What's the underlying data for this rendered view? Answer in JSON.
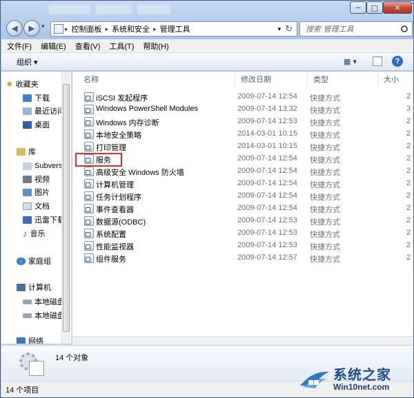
{
  "titlebar": {
    "minimize_glyph": "─",
    "maximize_glyph": "□",
    "close_glyph": "✕"
  },
  "address": {
    "back_glyph": "◀",
    "forward_glyph": "▶",
    "dropdown_glyph": "▾",
    "refresh_glyph": "↻",
    "crumbs": [
      "控制面板",
      "系统和安全",
      "管理工具"
    ],
    "search_placeholder": "搜索 管理工具"
  },
  "menu": [
    "文件(F)",
    "编辑(E)",
    "查看(V)",
    "工具(T)",
    "帮助(H)"
  ],
  "toolbar": {
    "organize_label": "组织 ▾",
    "view_glyph": "▦ ▾",
    "help_glyph": "?"
  },
  "sidebar": {
    "favorites": "收藏夹",
    "fav_items": [
      "下载",
      "最近访问",
      "桌面"
    ],
    "libraries": "库",
    "lib_items": [
      "Subvers",
      "视频",
      "图片",
      "文档",
      "迅雷下载",
      "音乐"
    ],
    "homegroup": "家庭组",
    "computer": "计算机",
    "drives": [
      "本地磁盘",
      "本地磁盘"
    ],
    "network": "网络"
  },
  "columns": {
    "name": "名称",
    "date": "修改日期",
    "type": "类型",
    "size": "大小"
  },
  "files": [
    {
      "name": "iSCSI 发起程序",
      "date": "2009-07-14 12:54",
      "type": "快捷方式",
      "size": "2"
    },
    {
      "name": "Windows PowerShell Modules",
      "date": "2009-07-14 13:32",
      "type": "快捷方式",
      "size": "3"
    },
    {
      "name": "Windows 内存诊断",
      "date": "2009-07-14 12:53",
      "type": "快捷方式",
      "size": "2"
    },
    {
      "name": "本地安全策略",
      "date": "2014-03-01 10:15",
      "type": "快捷方式",
      "size": "2"
    },
    {
      "name": "打印管理",
      "date": "2014-03-01 10:15",
      "type": "快捷方式",
      "size": "2"
    },
    {
      "name": "服务",
      "date": "2009-07-14 12:54",
      "type": "快捷方式",
      "size": "2"
    },
    {
      "name": "高级安全 Windows 防火墙",
      "date": "2009-07-14 12:54",
      "type": "快捷方式",
      "size": "2"
    },
    {
      "name": "计算机管理",
      "date": "2009-07-14 12:54",
      "type": "快捷方式",
      "size": "2"
    },
    {
      "name": "任务计划程序",
      "date": "2009-07-14 12:54",
      "type": "快捷方式",
      "size": "2"
    },
    {
      "name": "事件查看器",
      "date": "2009-07-14 12:54",
      "type": "快捷方式",
      "size": "2"
    },
    {
      "name": "数据源(ODBC)",
      "date": "2009-07-14 12:53",
      "type": "快捷方式",
      "size": "2"
    },
    {
      "name": "系统配置",
      "date": "2009-07-14 12:53",
      "type": "快捷方式",
      "size": "2"
    },
    {
      "name": "性能监视器",
      "date": "2009-07-14 12:53",
      "type": "快捷方式",
      "size": "2"
    },
    {
      "name": "组件服务",
      "date": "2009-07-14 12:57",
      "type": "快捷方式",
      "size": "2"
    }
  ],
  "details": {
    "count_text": "14 个对象"
  },
  "status": {
    "text": "14 个项目"
  },
  "watermark": {
    "main": "系统之家",
    "sub": "Win10net.com"
  },
  "colors": {
    "highlight": "#e3262b",
    "accent": "#1f4f8f"
  }
}
